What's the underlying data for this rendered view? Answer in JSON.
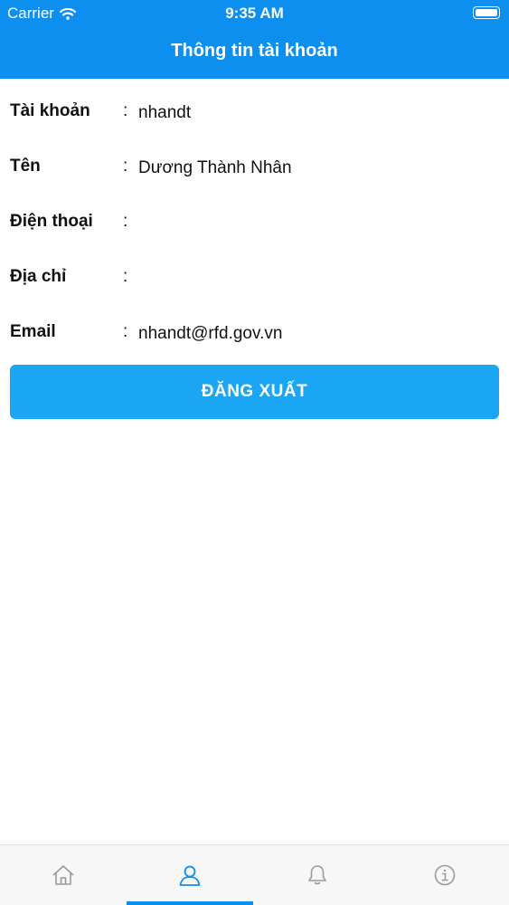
{
  "status_bar": {
    "carrier": "Carrier",
    "time": "9:35 AM"
  },
  "header": {
    "title": "Thông tin tài khoản"
  },
  "account_info": [
    {
      "label": "Tài khoản",
      "colon": ":",
      "value": "nhandt"
    },
    {
      "label": "Tên",
      "colon": ":",
      "value": "Dương Thành Nhân"
    },
    {
      "label": "Điện thoại",
      "colon": ":",
      "value": ""
    },
    {
      "label": "Địa chỉ",
      "colon": ":",
      "value": ""
    },
    {
      "label": "Email",
      "colon": ":",
      "value": "nhandt@rfd.gov.vn"
    }
  ],
  "logout_button": {
    "label": "ĐĂNG XUẤT"
  },
  "tab_bar": {
    "tabs": [
      {
        "icon": "home-icon"
      },
      {
        "icon": "user-icon",
        "active": true
      },
      {
        "icon": "bell-icon"
      },
      {
        "icon": "info-icon"
      }
    ]
  },
  "colors": {
    "header_bg": "#0d8ff0",
    "button_bg": "#1aa6f3",
    "tab_active": "#0d8ff0",
    "tab_inactive": "#9a9a9a"
  }
}
